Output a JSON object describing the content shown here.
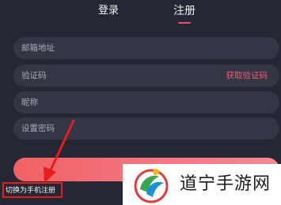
{
  "tabs": {
    "login": "登录",
    "register": "注册",
    "active_color": "#f04e63"
  },
  "form": {
    "email_placeholder": "邮箱地址",
    "code_placeholder": "验证码",
    "get_code_label": "获取验证码",
    "nickname_placeholder": "昵称",
    "password_placeholder": "设置密码"
  },
  "footer": {
    "switch_label": "切换为手机注册"
  },
  "watermark": {
    "text": "道宁手游网"
  },
  "colors": {
    "background": "#262735",
    "field": "#353645",
    "accent": "#f04e63",
    "annotation": "#e81c1c"
  }
}
